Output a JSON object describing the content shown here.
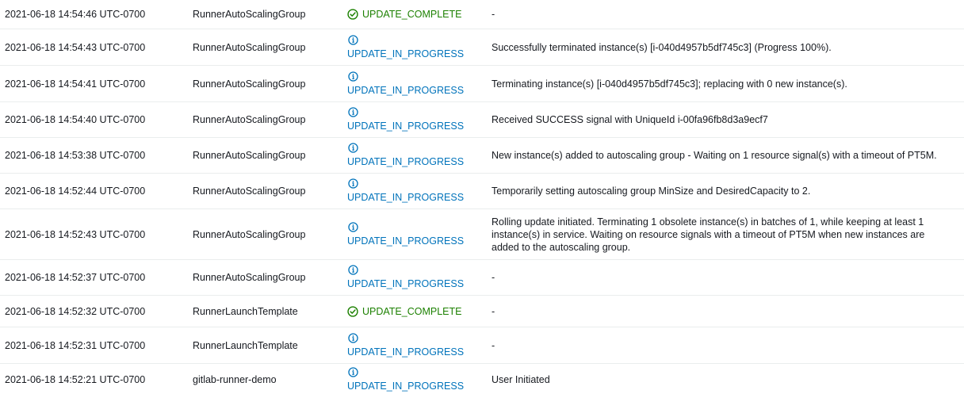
{
  "colors": {
    "complete": "#1d8102",
    "in_progress": "#0073bb",
    "text": "#16191f",
    "divider": "#eaeded"
  },
  "events": [
    {
      "timestamp": "2021-06-18 14:54:46 UTC-0700",
      "logical_id": "RunnerAutoScalingGroup",
      "status": "UPDATE_COMPLETE",
      "status_kind": "complete",
      "status_icon": "check-circle-icon",
      "reason": "-"
    },
    {
      "timestamp": "2021-06-18 14:54:43 UTC-0700",
      "logical_id": "RunnerAutoScalingGroup",
      "status": "UPDATE_IN_PROGRESS",
      "status_kind": "progress",
      "status_icon": "info-circle-icon",
      "reason": "Successfully terminated instance(s) [i-040d4957b5df745c3] (Progress 100%)."
    },
    {
      "timestamp": "2021-06-18 14:54:41 UTC-0700",
      "logical_id": "RunnerAutoScalingGroup",
      "status": "UPDATE_IN_PROGRESS",
      "status_kind": "progress",
      "status_icon": "info-circle-icon",
      "reason": "Terminating instance(s) [i-040d4957b5df745c3]; replacing with 0 new instance(s)."
    },
    {
      "timestamp": "2021-06-18 14:54:40 UTC-0700",
      "logical_id": "RunnerAutoScalingGroup",
      "status": "UPDATE_IN_PROGRESS",
      "status_kind": "progress",
      "status_icon": "info-circle-icon",
      "reason": "Received SUCCESS signal with UniqueId i-00fa96fb8d3a9ecf7"
    },
    {
      "timestamp": "2021-06-18 14:53:38 UTC-0700",
      "logical_id": "RunnerAutoScalingGroup",
      "status": "UPDATE_IN_PROGRESS",
      "status_kind": "progress",
      "status_icon": "info-circle-icon",
      "reason": "New instance(s) added to autoscaling group - Waiting on 1 resource signal(s) with a timeout of PT5M."
    },
    {
      "timestamp": "2021-06-18 14:52:44 UTC-0700",
      "logical_id": "RunnerAutoScalingGroup",
      "status": "UPDATE_IN_PROGRESS",
      "status_kind": "progress",
      "status_icon": "info-circle-icon",
      "reason": "Temporarily setting autoscaling group MinSize and DesiredCapacity to 2."
    },
    {
      "timestamp": "2021-06-18 14:52:43 UTC-0700",
      "logical_id": "RunnerAutoScalingGroup",
      "status": "UPDATE_IN_PROGRESS",
      "status_kind": "progress",
      "status_icon": "info-circle-icon",
      "reason": "Rolling update initiated. Terminating 1 obsolete instance(s) in batches of 1, while keeping at least 1 instance(s) in service. Waiting on resource signals with a timeout of PT5M when new instances are added to the autoscaling group."
    },
    {
      "timestamp": "2021-06-18 14:52:37 UTC-0700",
      "logical_id": "RunnerAutoScalingGroup",
      "status": "UPDATE_IN_PROGRESS",
      "status_kind": "progress",
      "status_icon": "info-circle-icon",
      "reason": "-"
    },
    {
      "timestamp": "2021-06-18 14:52:32 UTC-0700",
      "logical_id": "RunnerLaunchTemplate",
      "status": "UPDATE_COMPLETE",
      "status_kind": "complete",
      "status_icon": "check-circle-icon",
      "reason": "-"
    },
    {
      "timestamp": "2021-06-18 14:52:31 UTC-0700",
      "logical_id": "RunnerLaunchTemplate",
      "status": "UPDATE_IN_PROGRESS",
      "status_kind": "progress",
      "status_icon": "info-circle-icon",
      "reason": "-"
    },
    {
      "timestamp": "2021-06-18 14:52:21 UTC-0700",
      "logical_id": "gitlab-runner-demo",
      "status": "UPDATE_IN_PROGRESS",
      "status_kind": "progress",
      "status_icon": "info-circle-icon",
      "reason": "User Initiated"
    }
  ]
}
